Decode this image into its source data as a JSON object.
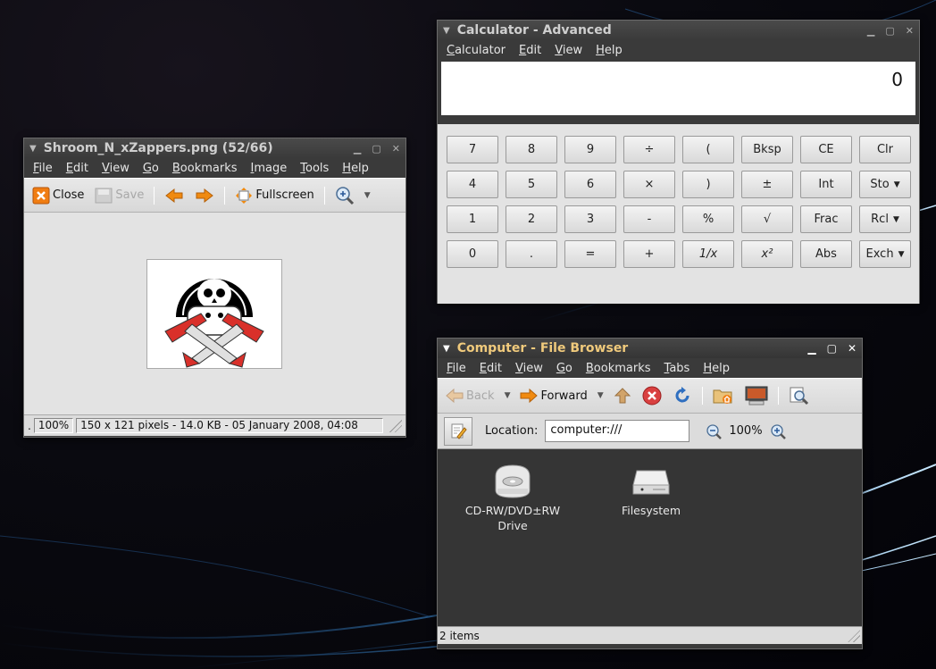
{
  "viewer": {
    "title": "Shroom_N_xZappers.png  (52/66)",
    "menu": [
      "File",
      "Edit",
      "View",
      "Go",
      "Bookmarks",
      "Image",
      "Tools",
      "Help"
    ],
    "toolbar": {
      "close": "Close",
      "save": "Save",
      "fullscreen": "Fullscreen"
    },
    "status": {
      "lead": ".",
      "zoom": "100%",
      "info": "150 x 121 pixels - 14.0 KB - 05 January 2008, 04:08"
    }
  },
  "calculator": {
    "title": "Calculator - Advanced",
    "menu": [
      "Calculator",
      "Edit",
      "View",
      "Help"
    ],
    "display": "0",
    "keys": [
      [
        "7",
        "8",
        "9",
        "÷",
        "(",
        "Bksp",
        "CE",
        "Clr"
      ],
      [
        "4",
        "5",
        "6",
        "×",
        ")",
        "±",
        "Int",
        "Sto"
      ],
      [
        "1",
        "2",
        "3",
        "-",
        "%",
        "√",
        "Frac",
        "Rcl"
      ],
      [
        "0",
        ".",
        "=",
        "+",
        "1/x",
        "x²",
        "Abs",
        "Exch"
      ]
    ]
  },
  "files": {
    "title": "Computer - File Browser",
    "menu": [
      "File",
      "Edit",
      "View",
      "Go",
      "Bookmarks",
      "Tabs",
      "Help"
    ],
    "toolbar": {
      "back": "Back",
      "forward": "Forward"
    },
    "location": {
      "label": "Location:",
      "value": "computer:///",
      "zoom": "100%"
    },
    "items": [
      {
        "label_line1": "CD-RW/DVD±RW",
        "label_line2": "Drive"
      },
      {
        "label_line1": "Filesystem",
        "label_line2": ""
      }
    ],
    "status": "2 items"
  },
  "colors": {
    "active_title": "#f0ca7c",
    "toolbar_icon_orange": "#f08a10"
  }
}
